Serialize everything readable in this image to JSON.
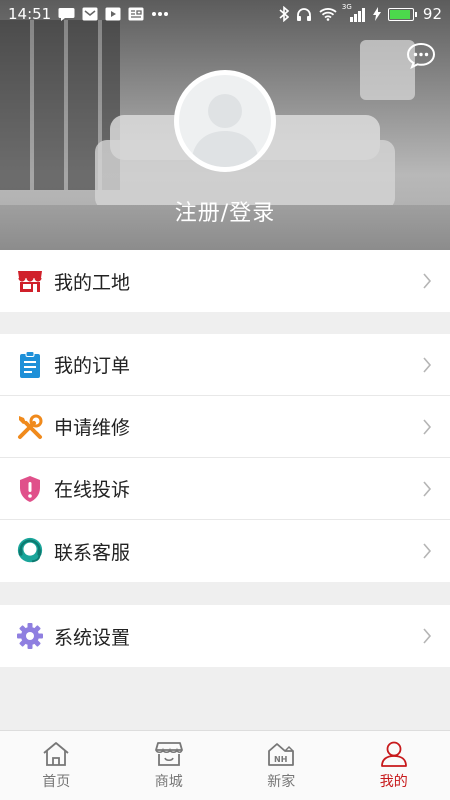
{
  "status_bar": {
    "time": "14:51",
    "battery_level": "92",
    "battery_fraction": 0.92,
    "network_label": "3G",
    "left_icons": [
      "message-icon",
      "mail-icon",
      "play-icon",
      "news-icon",
      "more-dots-icon"
    ],
    "right_icons": [
      "bluetooth-icon",
      "headphones-icon",
      "wifi-icon",
      "signal-icon",
      "charging-icon",
      "battery-icon"
    ]
  },
  "profile": {
    "login_label": "注册/登录",
    "avatar": "default-avatar-icon",
    "message_icon": "chat-bubble-icon"
  },
  "menu": {
    "site": {
      "label": "我的工地",
      "icon": "shop-icon",
      "color": "#d0202a"
    },
    "orders": {
      "label": "我的订单",
      "icon": "clipboard-icon",
      "color": "#1e90d8"
    },
    "repair": {
      "label": "申请维修",
      "icon": "tools-icon",
      "color": "#f08a1c"
    },
    "complaint": {
      "label": "在线投诉",
      "icon": "shield-alert-icon",
      "color": "#e0508a"
    },
    "service": {
      "label": "联系客服",
      "icon": "headset-icon",
      "color": "#1aa59a"
    },
    "settings": {
      "label": "系统设置",
      "icon": "gear-icon",
      "color": "#8f7fe0"
    }
  },
  "tabbar": {
    "home": {
      "label": "首页",
      "icon": "home-icon"
    },
    "mall": {
      "label": "商城",
      "icon": "store-icon"
    },
    "new_home": {
      "label": "新家",
      "icon": "nh-house-icon",
      "badge": "NH"
    },
    "mine": {
      "label": "我的",
      "icon": "user-icon",
      "active": true
    },
    "active_color": "#c7191b"
  }
}
